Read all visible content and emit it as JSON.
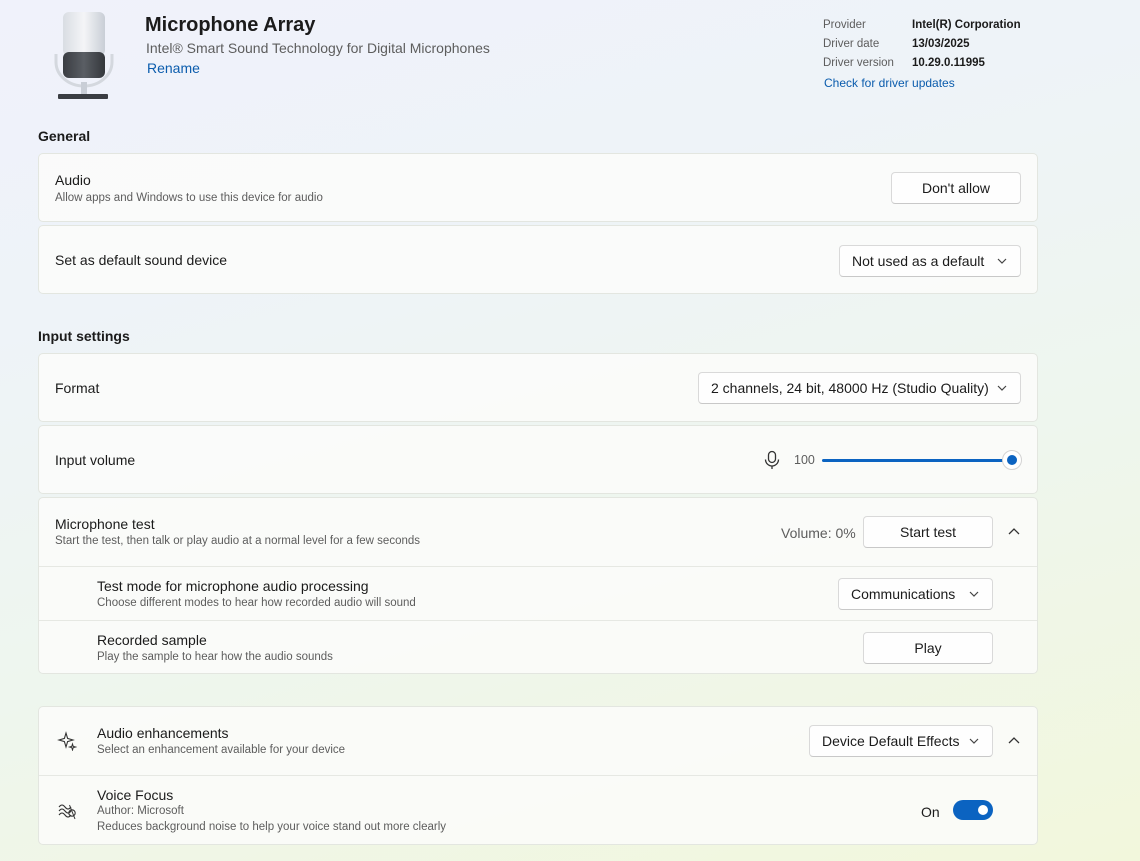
{
  "device": {
    "name": "Microphone Array",
    "subtitle": "Intel® Smart Sound Technology for Digital Microphones",
    "rename": "Rename"
  },
  "driver": {
    "provider_label": "Provider",
    "provider_value": "Intel(R) Corporation",
    "date_label": "Driver date",
    "date_value": "13/03/2025",
    "version_label": "Driver version",
    "version_value": "10.29.0.11995",
    "check_link": "Check for driver updates"
  },
  "general": {
    "title": "General",
    "audio_title": "Audio",
    "audio_desc": "Allow apps and Windows to use this device for audio",
    "audio_button": "Don't allow",
    "default_title": "Set as default sound device",
    "default_value": "Not used as a default"
  },
  "input": {
    "title": "Input settings",
    "format_title": "Format",
    "format_value": "2 channels, 24 bit, 48000 Hz (Studio Quality)",
    "volume_title": "Input volume",
    "volume_value": "100",
    "volume_level": 100
  },
  "mic_test": {
    "title": "Microphone test",
    "desc": "Start the test, then talk or play audio at a normal level for a few seconds",
    "volume_readout": "Volume: 0%",
    "start_button": "Start test",
    "mode_title": "Test mode for microphone audio processing",
    "mode_desc": "Choose different modes to hear how recorded audio will sound",
    "mode_value": "Communications",
    "sample_title": "Recorded sample",
    "sample_desc": "Play the sample to hear how the audio sounds",
    "play_button": "Play"
  },
  "enhancements": {
    "title": "Audio enhancements",
    "desc": "Select an enhancement available for your device",
    "value": "Device Default Effects",
    "voice_focus_title": "Voice Focus",
    "voice_focus_author": "Author: Microsoft",
    "voice_focus_desc": "Reduces background noise to help your voice stand out more clearly",
    "voice_focus_state": "On",
    "voice_focus_on": true
  },
  "colors": {
    "accent": "#0b63c1",
    "link": "#0b5cad"
  }
}
